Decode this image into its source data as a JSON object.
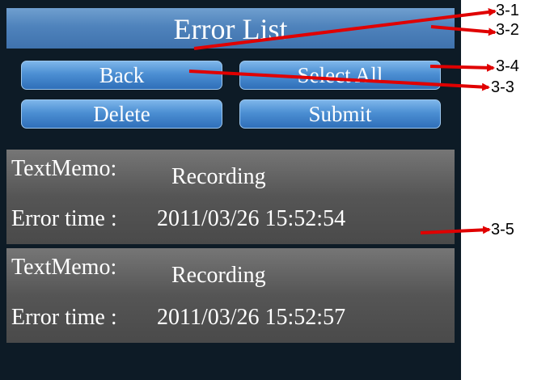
{
  "window": {
    "title": "Error List"
  },
  "buttons": {
    "back": "Back",
    "select_all": "Select All",
    "delete": "Delete",
    "submit": "Submit"
  },
  "errors": [
    {
      "memo_label": "TextMemo:",
      "memo_value": "Recording",
      "time_label": "Error time :",
      "time_value": "2011/03/26 15:52:54"
    },
    {
      "memo_label": "TextMemo:",
      "memo_value": "Recording",
      "time_label": "Error time :",
      "time_value": "2011/03/26 15:52:57"
    }
  ],
  "callouts": {
    "c1": "3-1",
    "c2": "3-2",
    "c3": "3-3",
    "c4": "3-4",
    "c5": "3-5"
  },
  "colors": {
    "arrow": "#e00000",
    "title_bar": "#4f83bc",
    "button": "#4c8fd3",
    "row": "#5a5a5a",
    "screen_bg": "#0d1b26"
  }
}
